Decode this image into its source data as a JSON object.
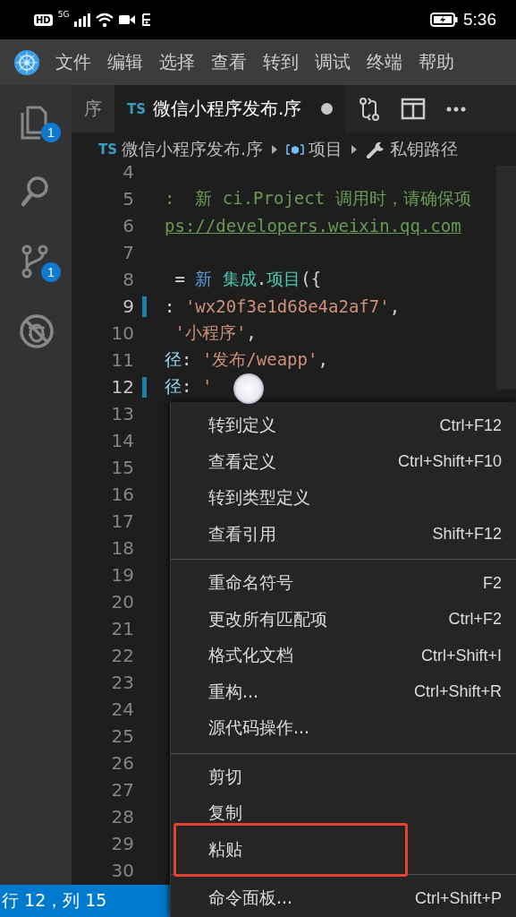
{
  "phone_status": {
    "badge": "HD",
    "network": "5G",
    "time": "5:36"
  },
  "menu_bar": [
    "文件",
    "编辑",
    "选择",
    "查看",
    "转到",
    "调试",
    "终端",
    "帮助"
  ],
  "activity_bar": [
    {
      "kind": "files",
      "badge": "1",
      "selected": false
    },
    {
      "kind": "search",
      "selected": false
    },
    {
      "kind": "source-control",
      "badge": "1",
      "selected": false
    },
    {
      "kind": "debug",
      "selected": false
    }
  ],
  "tabs": [
    {
      "label": "序",
      "selected": false,
      "modified": false
    },
    {
      "label": "微信小程序发布.序",
      "lang": "TS",
      "selected": true,
      "modified": true
    }
  ],
  "breadcrumb": [
    {
      "kind": "file",
      "lang": "TS",
      "label": "微信小程序发布.序"
    },
    {
      "kind": "module",
      "label": "项目"
    },
    {
      "kind": "property",
      "label": "私钥路径"
    }
  ],
  "editor": {
    "lines": [
      {
        "number": "4"
      },
      {
        "number": "5",
        "tokens": [
          {
            "kind": "comment",
            "text": ":  新 ci.Project 调用时，请确保项"
          }
        ]
      },
      {
        "number": "6",
        "tokens": [
          {
            "kind": "link",
            "text": "ps://developers.weixin.qq.com"
          }
        ]
      },
      {
        "number": "7"
      },
      {
        "number": "8",
        "tokens": [
          {
            "kind": "plain",
            "text": " = "
          },
          {
            "kind": "keyword",
            "text": "新 "
          },
          {
            "kind": "class",
            "text": "集成"
          },
          {
            "kind": "plain",
            "text": "."
          },
          {
            "kind": "class",
            "text": "项目"
          },
          {
            "kind": "plain",
            "text": "({"
          }
        ]
      },
      {
        "number": "9",
        "changed": true,
        "tokens": [
          {
            "kind": "plain",
            "text": ": "
          },
          {
            "kind": "string",
            "text": "'wx20f3e1d68e4a2af7'"
          },
          {
            "kind": "plain",
            "text": ","
          }
        ]
      },
      {
        "number": "10",
        "tokens": [
          {
            "kind": "string",
            "text": " '小程序'"
          },
          {
            "kind": "plain",
            "text": ","
          }
        ]
      },
      {
        "number": "11",
        "tokens": [
          {
            "kind": "property",
            "text": "径"
          },
          {
            "kind": "plain",
            "text": ": "
          },
          {
            "kind": "string",
            "text": "'发布/weapp'"
          },
          {
            "kind": "plain",
            "text": ","
          }
        ]
      },
      {
        "number": "12",
        "changed": true,
        "tokens": [
          {
            "kind": "property",
            "text": "径"
          },
          {
            "kind": "plain",
            "text": ": "
          },
          {
            "kind": "string",
            "text": "'"
          }
        ]
      },
      {
        "number": "13"
      },
      {
        "number": "14"
      },
      {
        "number": "15"
      },
      {
        "number": "16"
      },
      {
        "number": "17"
      },
      {
        "number": "18"
      },
      {
        "number": "19"
      },
      {
        "number": "20"
      },
      {
        "number": "21"
      },
      {
        "number": "22"
      },
      {
        "number": "23"
      },
      {
        "number": "24"
      },
      {
        "number": "25"
      },
      {
        "number": "26"
      },
      {
        "number": "27"
      },
      {
        "number": "28"
      },
      {
        "number": "29"
      },
      {
        "number": "30"
      }
    ]
  },
  "context_menu": {
    "groups": [
      [
        {
          "label": "转到定义",
          "shortcut": "Ctrl+F12",
          "highlighted": false
        },
        {
          "label": "查看定义",
          "shortcut": "Ctrl+Shift+F10",
          "highlighted": false
        },
        {
          "label": "转到类型定义",
          "highlighted": false
        },
        {
          "label": "查看引用",
          "shortcut": "Shift+F12",
          "highlighted": false
        }
      ],
      [
        {
          "label": "重命名符号",
          "shortcut": "F2",
          "highlighted": false
        },
        {
          "label": "更改所有匹配项",
          "shortcut": "Ctrl+F2",
          "highlighted": false
        },
        {
          "label": "格式化文档",
          "shortcut": "Ctrl+Shift+I",
          "highlighted": false
        },
        {
          "label": "重构...",
          "shortcut": "Ctrl+Shift+R",
          "highlighted": false
        },
        {
          "label": "源代码操作...",
          "highlighted": false
        }
      ],
      [
        {
          "label": "剪切",
          "highlighted": false
        },
        {
          "label": "复制",
          "highlighted": false
        },
        {
          "label": "粘贴",
          "highlighted": true
        }
      ],
      [
        {
          "label": "命令面板...",
          "shortcut": "Ctrl+Shift+P",
          "highlighted": false
        }
      ]
    ]
  },
  "status_bar": {
    "position": "行 12，列 15"
  }
}
